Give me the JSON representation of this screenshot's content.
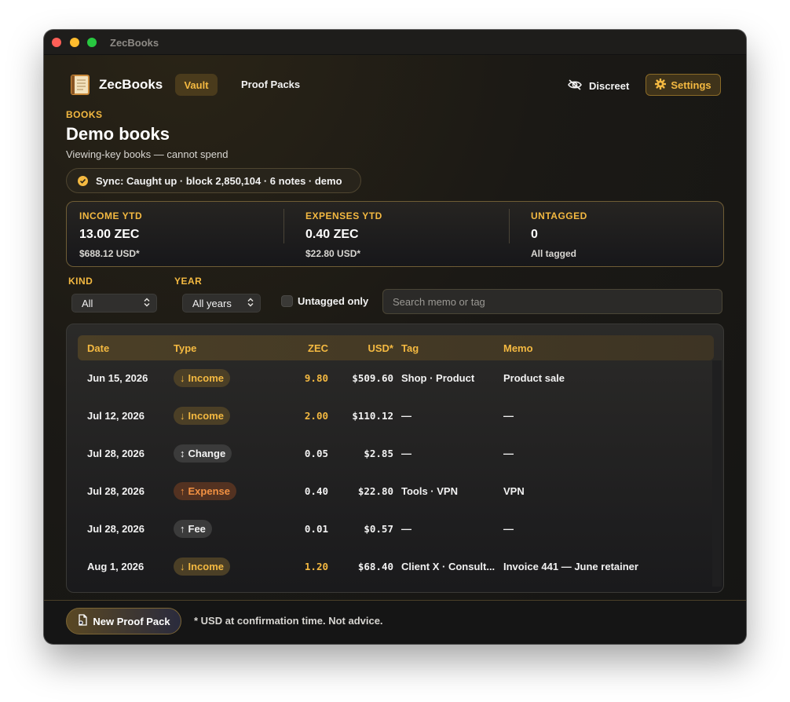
{
  "window": {
    "title": "ZecBooks"
  },
  "header": {
    "brand": "ZecBooks",
    "nav": {
      "vault": "Vault",
      "proof_packs": "Proof Packs"
    },
    "discreet": "Discreet",
    "settings": "Settings"
  },
  "page": {
    "eyebrow": "BOOKS",
    "title": "Demo books",
    "subtitle": "Viewing-key books — cannot spend",
    "sync": "Sync: Caught up · block 2,850,104 · 6 notes · demo"
  },
  "stats": [
    {
      "label": "INCOME YTD",
      "value": "13.00 ZEC",
      "sub": "$688.12 USD*"
    },
    {
      "label": "EXPENSES YTD",
      "value": "0.40 ZEC",
      "sub": "$22.80 USD*"
    },
    {
      "label": "UNTAGGED",
      "value": "0",
      "sub": "All tagged"
    }
  ],
  "filters": {
    "kind_label": "KIND",
    "kind_value": "All",
    "year_label": "YEAR",
    "year_value": "All years",
    "untagged_label": "Untagged only",
    "search_placeholder": "Search memo or tag"
  },
  "table": {
    "headers": {
      "date": "Date",
      "type": "Type",
      "zec": "ZEC",
      "usd": "USD*",
      "tag": "Tag",
      "memo": "Memo"
    },
    "rows": [
      {
        "date": "Jun 15, 2026",
        "type": "Income",
        "type_arrow": "↓",
        "zec": "9.80",
        "usd": "$509.60",
        "tag": "Shop · Product",
        "memo": "Product sale"
      },
      {
        "date": "Jul 12, 2026",
        "type": "Income",
        "type_arrow": "↓",
        "zec": "2.00",
        "usd": "$110.12",
        "tag": "—",
        "memo": "—"
      },
      {
        "date": "Jul 28, 2026",
        "type": "Change",
        "type_arrow": "↕",
        "zec": "0.05",
        "usd": "$2.85",
        "tag": "—",
        "memo": "—"
      },
      {
        "date": "Jul 28, 2026",
        "type": "Expense",
        "type_arrow": "↑",
        "zec": "0.40",
        "usd": "$22.80",
        "tag": "Tools · VPN",
        "memo": "VPN"
      },
      {
        "date": "Jul 28, 2026",
        "type": "Fee",
        "type_arrow": "↑",
        "zec": "0.01",
        "usd": "$0.57",
        "tag": "—",
        "memo": "—"
      },
      {
        "date": "Aug 1, 2026",
        "type": "Income",
        "type_arrow": "↓",
        "zec": "1.20",
        "usd": "$68.40",
        "tag": "Client X · Consult...",
        "memo": "Invoice 441 — June retainer"
      }
    ]
  },
  "footer": {
    "new_proof_pack": "New Proof Pack",
    "note": "* USD at confirmation time. Not advice."
  },
  "colors": {
    "accent": "#f4b941",
    "expense": "#f29142",
    "background": "#181715"
  },
  "icons": {
    "logo": "book-icon",
    "discreet": "eye-slash-icon",
    "settings": "gear-icon",
    "sync": "check-circle-icon",
    "new_proof": "document-icon"
  }
}
